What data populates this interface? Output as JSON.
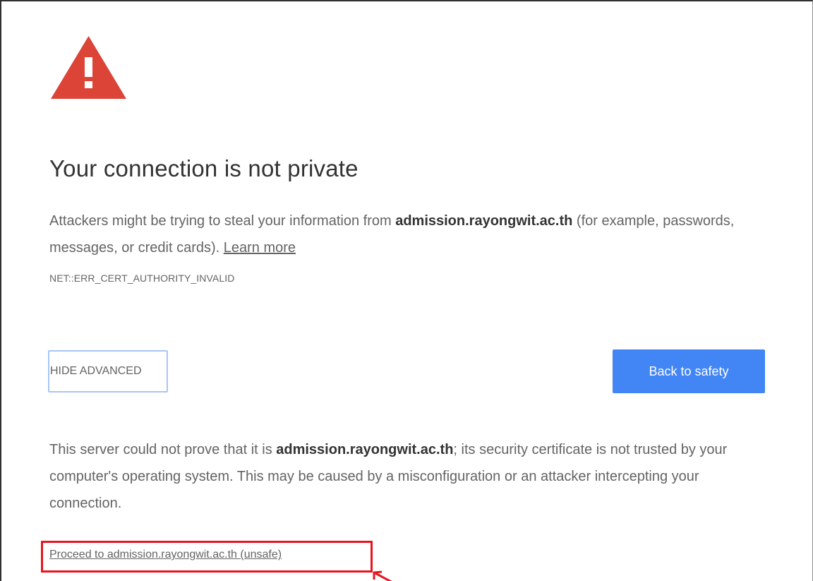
{
  "interstitial": {
    "title": "Your connection is not private",
    "message": {
      "part1": "Attackers might be trying to steal your information from ",
      "host": "admission.rayongwit.ac.th",
      "part2": " (for example, passwords, messages, or credit cards). ",
      "learn_more": "Learn more"
    },
    "error_code": "NET::ERR_CERT_AUTHORITY_INVALID",
    "buttons": {
      "hide_advanced": "HIDE ADVANCED",
      "back_to_safety": "Back to safety"
    },
    "details": {
      "part1": "This server could not prove that it is ",
      "host": "admission.rayongwit.ac.th",
      "part2": "; its security certificate is not trusted by your computer's operating system. This may be caused by a misconfiguration or an attacker intercepting your connection."
    },
    "proceed_link": "Proceed to admission.rayongwit.ac.th (unsafe)"
  },
  "icons": {
    "warning": "warning-triangle-icon",
    "annotation": "annotation-arrow-icon"
  },
  "colors": {
    "warning_red": "#db4437",
    "primary_blue": "#4285f4",
    "annotation_red": "#e8141e",
    "text_gray": "#646464",
    "title_dark": "#333333"
  }
}
